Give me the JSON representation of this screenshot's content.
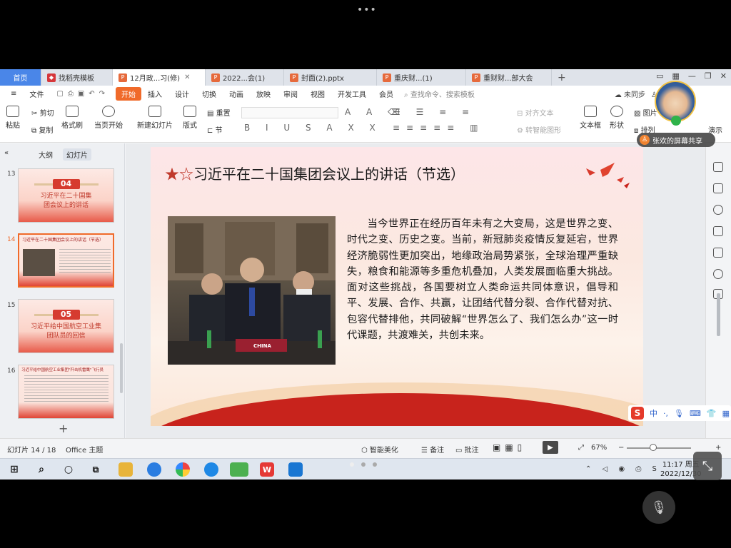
{
  "tabs": [
    {
      "label": "首页",
      "kind": "home"
    },
    {
      "label": "找稻壳模板",
      "kind": "template"
    },
    {
      "label": "12月政...习(修)",
      "kind": "pptx",
      "active": true
    },
    {
      "label": "2022...会(1)",
      "kind": "pptx"
    },
    {
      "label": "封面(2).pptx",
      "kind": "pptx"
    },
    {
      "label": "重庆财...(1)",
      "kind": "pptx"
    },
    {
      "label": "重财财...部大会",
      "kind": "pptx"
    }
  ],
  "menu": {
    "file": "文件",
    "items": [
      "开始",
      "插入",
      "设计",
      "切换",
      "动画",
      "放映",
      "审阅",
      "视图",
      "开发工具",
      "会员"
    ],
    "active": "开始",
    "search_placeholder": "查找命令、搜索模板",
    "unsynced": "未同步",
    "collab": "协作"
  },
  "ribbon": {
    "paste": "粘贴",
    "cut": "剪切",
    "copy": "复制",
    "format_painter": "格式刷",
    "from_current": "当页开始",
    "new_slide": "新建幻灯片",
    "layout": "版式",
    "section": "节",
    "reset": "重置",
    "align_text": "对齐文本",
    "to_smartart": "转智能图形",
    "textbox": "文本框",
    "shape": "形状",
    "picture": "图片",
    "arrange": "排列",
    "present": "演示"
  },
  "left_panel": {
    "tab_outline": "大纲",
    "tab_slides": "幻灯片",
    "thumbnails": [
      {
        "num": "13",
        "badge": "04",
        "title": "习近平在二十国集团会议上的讲话"
      },
      {
        "num": "14",
        "selected": true,
        "title": "习近平在二十国集团会议上的讲话（节选）"
      },
      {
        "num": "15",
        "badge": "05",
        "title": "习近平给中国航空工业集团队员的回信"
      },
      {
        "num": "16",
        "title": "习近平给中国航空工业集团\"歼击机雷鹰\"飞行员"
      }
    ],
    "add": "+"
  },
  "slide": {
    "title_stars": "★☆",
    "title": "习近平在二十国集团会议上的讲话（节选）",
    "photo_label": "CHINA",
    "body": "当今世界正在经历百年未有之大变局，这是世界之变、时代之变、历史之变。当前，新冠肺炎疫情反复延宕，世界经济脆弱性更加突出，地缘政治局势紧张，全球治理严重缺失，粮食和能源等多重危机叠加，人类发展面临重大挑战。面对这些挑战，各国要树立人类命运共同体意识，倡导和平、发展、合作、共赢，让团结代替分裂、合作代替对抗、包容代替排他，共同破解“世界怎么了、我们怎么办”这一时代课题，共渡难关，共创未来。"
  },
  "share_badge": "张欢的屏幕共享",
  "ime": {
    "logo": "S",
    "mode": "中"
  },
  "status": {
    "slide_index": "幻灯片 14 / 18",
    "theme": "Office 主题",
    "beautify": "智能美化",
    "notes": "备注",
    "comment": "批注",
    "zoom": "67%",
    "zoom_minus": "−",
    "zoom_plus": "+"
  },
  "taskbar": {
    "time": "11:17 周五",
    "date": "2022/12/30",
    "wps_logo": "W"
  },
  "colors": {
    "accent": "#f06a2a",
    "home_tab": "#4a86e8",
    "slide_red": "#c8231c"
  }
}
